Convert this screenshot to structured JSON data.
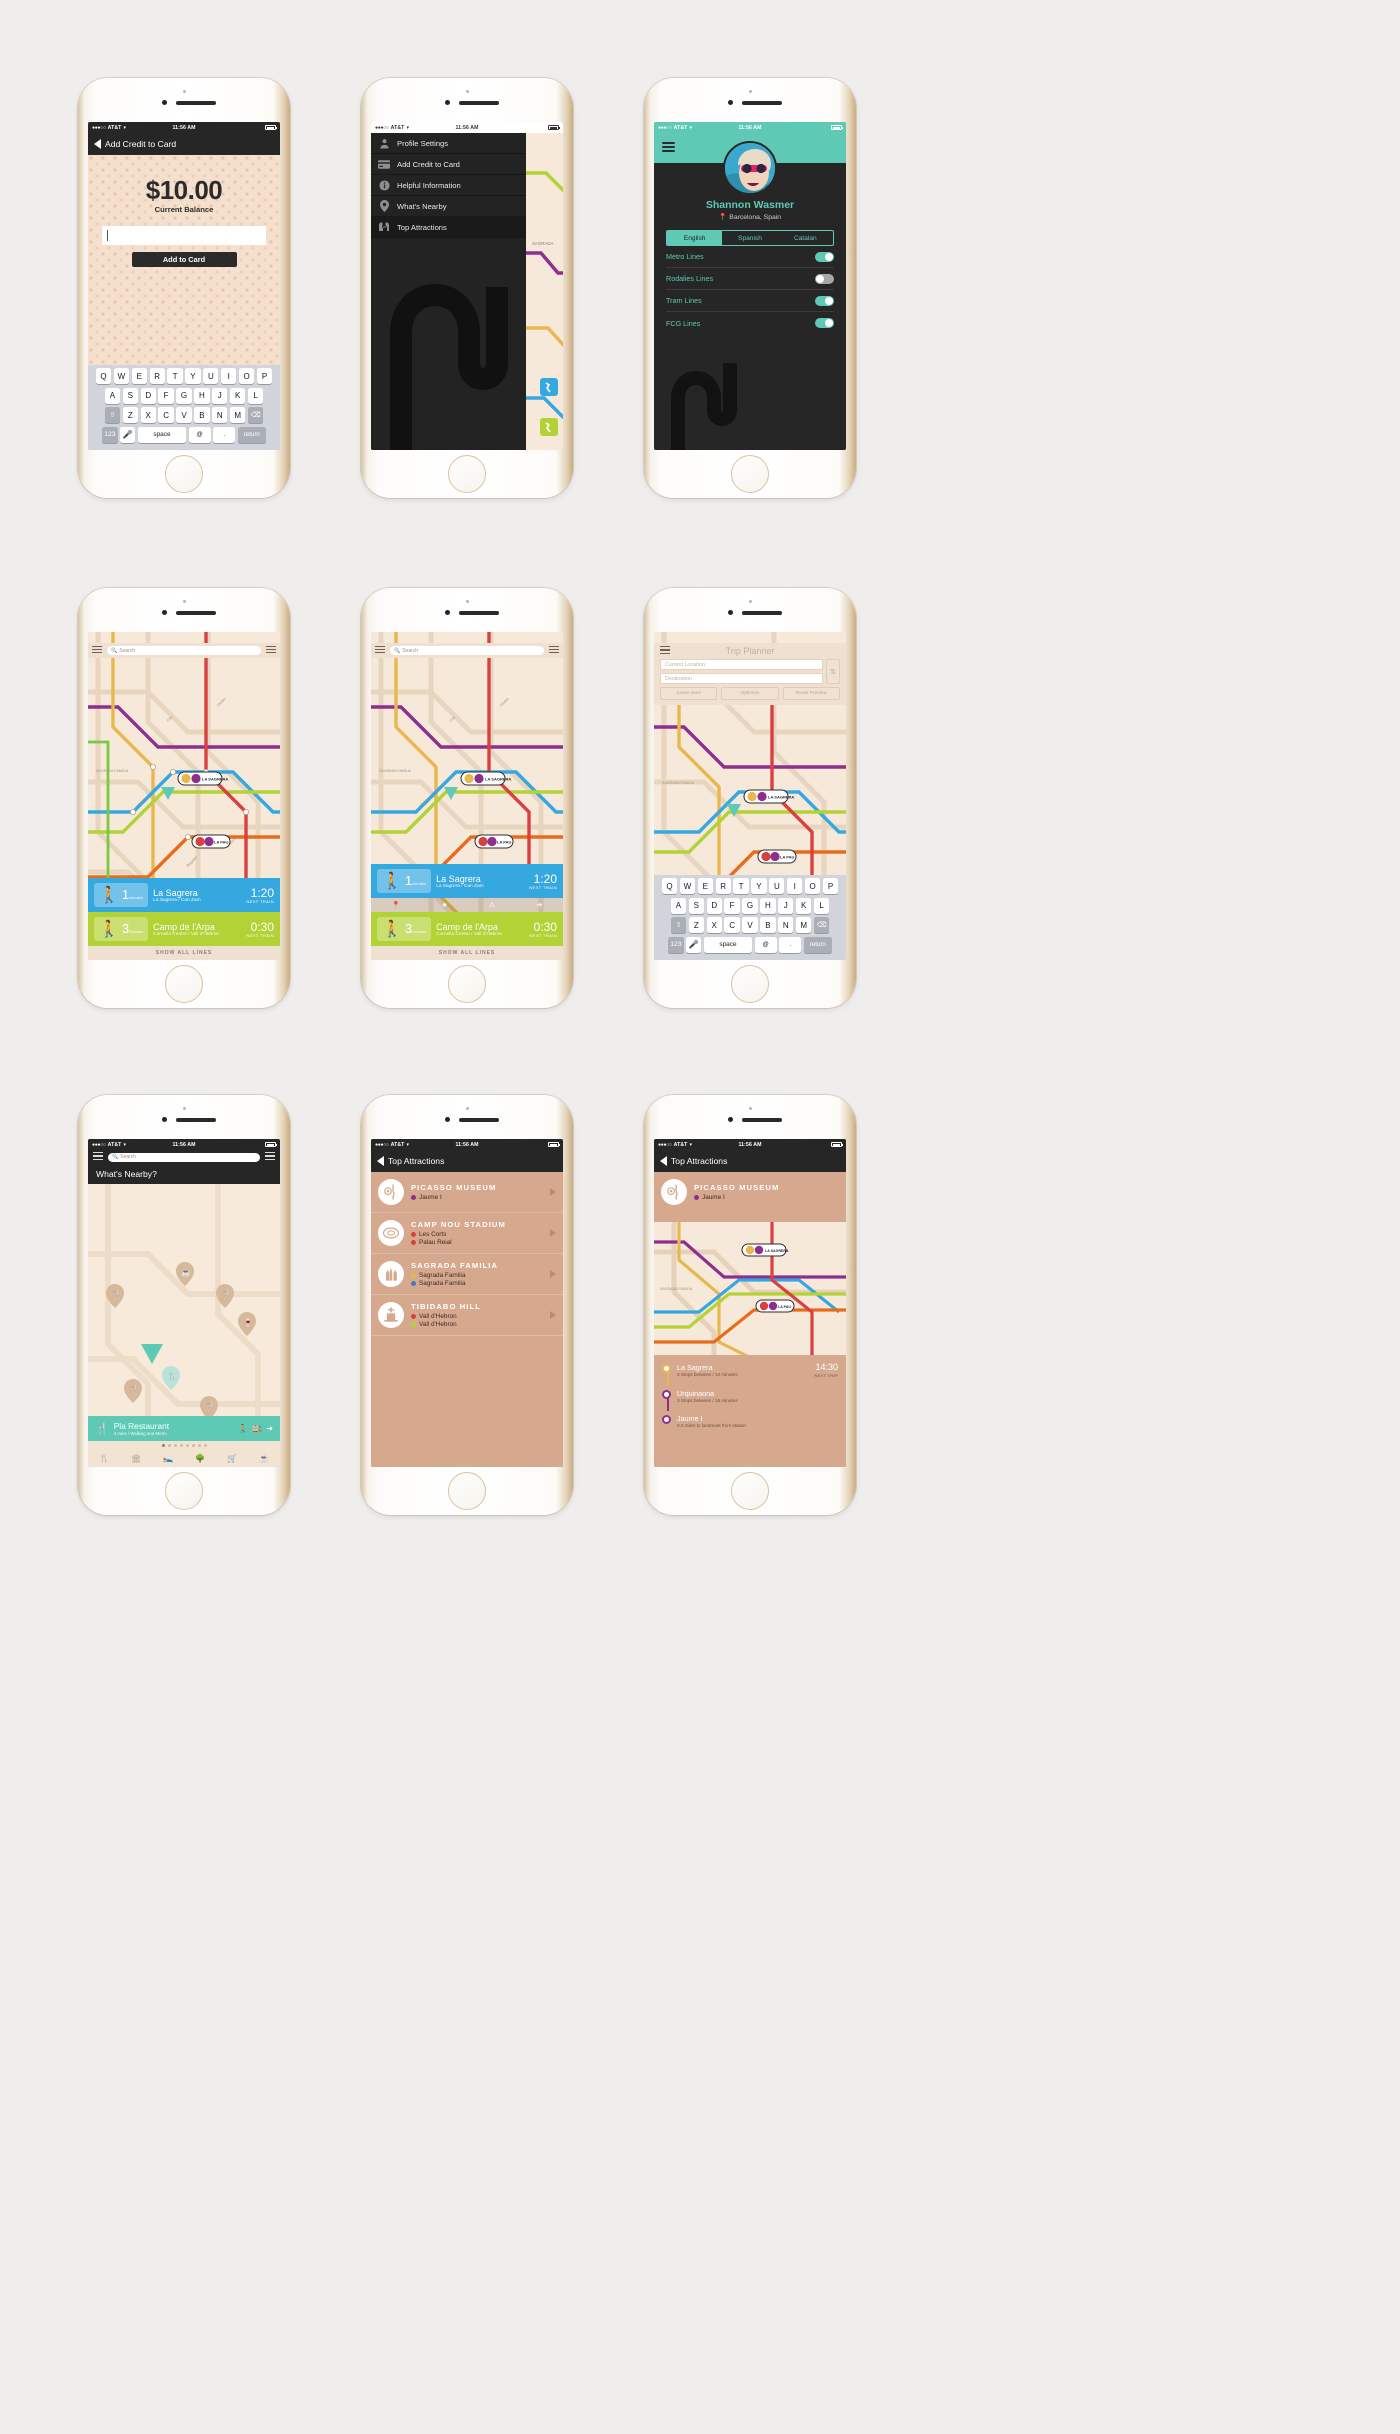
{
  "status_bar": {
    "signal": "●●●○○",
    "carrier": "AT&T",
    "time": "11:56 AM"
  },
  "p1": {
    "nav_title": "Add Credit to Card",
    "amount": "$10.00",
    "amount_label": "Current Balance",
    "input_value": "",
    "button": "Add to Card",
    "keyboard": {
      "row1": [
        "Q",
        "W",
        "E",
        "R",
        "T",
        "Y",
        "U",
        "I",
        "O",
        "P"
      ],
      "row2": [
        "A",
        "S",
        "D",
        "F",
        "G",
        "H",
        "J",
        "K",
        "L"
      ],
      "row3": [
        "Z",
        "X",
        "C",
        "V",
        "B",
        "N",
        "M"
      ],
      "shift": "⇧",
      "backspace": "⌫",
      "num": "123",
      "mic": "\u0001",
      "space": "space",
      "at": "@",
      "period": ".",
      "return": "return"
    }
  },
  "p2": {
    "menu": [
      {
        "label": "Profile Settings",
        "icon": "person-icon"
      },
      {
        "label": "Add Credit to Card",
        "icon": "card-icon"
      },
      {
        "label": "Helpful Information",
        "icon": "info-icon"
      },
      {
        "label": "What's Nearby",
        "icon": "pin-icon"
      },
      {
        "label": "Top Attractions",
        "icon": "metro-icon"
      }
    ],
    "map_label": "SAGRADA"
  },
  "p3": {
    "name": "Shannon Wasmer",
    "location": "Barcelona, Spain",
    "languages": [
      {
        "label": "English",
        "on": true
      },
      {
        "label": "Spanish",
        "on": false
      },
      {
        "label": "Catalan",
        "on": false
      }
    ],
    "toggles": [
      {
        "label": "Metro Lines",
        "on": true
      },
      {
        "label": "Rodalies Lines",
        "on": false
      },
      {
        "label": "Tram Lines",
        "on": true
      },
      {
        "label": "FCG Lines",
        "on": true
      }
    ],
    "accent": "#5ec9b5"
  },
  "p4": {
    "search_placeholder": "Search",
    "routes": [
      {
        "num": "1",
        "unit": "minutes",
        "name": "La Sagrera",
        "sub": "La Sagrera / Can Zam",
        "time": "1:20",
        "time_label": "NEXT TRAIN",
        "color": "#35a8e0"
      },
      {
        "num": "3",
        "unit": "minutes",
        "name": "Camp de l'Arpa",
        "sub": "Cornella Centre / Vall d'Hebron",
        "time": "0:30",
        "time_label": "NEXT TRAIN",
        "color": "#b2d235"
      }
    ],
    "show_all": "SHOW ALL LINES",
    "station_a": "LA SAGRERA",
    "station_b": "LA PAU"
  },
  "p5": {
    "search_placeholder": "Search",
    "routes": [
      {
        "num": "1",
        "unit": "minutes",
        "name": "La Sagrera",
        "sub": "La Sagrera / Can Zam",
        "time": "1:20",
        "time_label": "NEXT TRAIN",
        "color": "#35a8e0"
      },
      {
        "num": "3",
        "unit": "minutes",
        "name": "Camp de l'Arpa",
        "sub": "Cornella Centre / Vall d'Hebron",
        "time": "0:30",
        "time_label": "NEXT TRAIN",
        "color": "#b2d235"
      }
    ],
    "action_icons": [
      "pin-icon",
      "star-icon",
      "warning-icon",
      "share-icon"
    ],
    "show_all": "SHOW ALL LINES"
  },
  "p6": {
    "title": "Trip Planner",
    "origin_placeholder": "Current Location",
    "dest_placeholder": "Destination",
    "buttons": [
      "Leave Now",
      "Optimize",
      "Route Preview"
    ],
    "swap_icon": "swap-icon",
    "keyboard": {
      "row1": [
        "Q",
        "W",
        "E",
        "R",
        "T",
        "Y",
        "U",
        "I",
        "O",
        "P"
      ],
      "row2": [
        "A",
        "S",
        "D",
        "F",
        "G",
        "H",
        "J",
        "K",
        "L"
      ],
      "row3": [
        "Z",
        "X",
        "C",
        "V",
        "B",
        "N",
        "M"
      ],
      "shift": "⇧",
      "backspace": "⌫",
      "num": "123",
      "space": "space",
      "at": "@",
      "period": ".",
      "return": "return"
    }
  },
  "p7": {
    "search_placeholder": "Search",
    "title": "What's Nearby?",
    "card_title": "Pla Restaurant",
    "card_sub": "4 mins / Walking and Metro",
    "categories": [
      "restaurant-icon",
      "museum-icon",
      "hotel-icon",
      "park-icon",
      "shopping-icon",
      "coffee-icon"
    ]
  },
  "p8": {
    "nav_title": "Top Attractions",
    "items": [
      {
        "name": "PICASSO MUSEUM",
        "icon": "picasso-icon",
        "stops": [
          {
            "label": "Jaume I",
            "color": "#8e2f8e"
          }
        ]
      },
      {
        "name": "CAMP NOU STADIUM",
        "icon": "stadium-icon",
        "stops": [
          {
            "label": "Les Corts",
            "color": "#d94141"
          },
          {
            "label": "Palau Reial",
            "color": "#d94141"
          }
        ]
      },
      {
        "name": "SAGRADA FAMILIA",
        "icon": "sagrada-icon",
        "stops": [
          {
            "label": "Sagrada Familia",
            "color": "#e8b84f"
          },
          {
            "label": "Sagrada Familia",
            "color": "#4a77c4"
          }
        ]
      },
      {
        "name": "TIBIDABO HILL",
        "icon": "tibidabo-icon",
        "stops": [
          {
            "label": "Vall d'Hebron",
            "color": "#d94141"
          },
          {
            "label": "Vall d'Hebron",
            "color": "#b2d235"
          }
        ]
      }
    ]
  },
  "p9": {
    "nav_title": "Top Attractions",
    "header": {
      "name": "PICASSO MUSEUM",
      "stop": "Jaume I",
      "stop_color": "#8e2f8e"
    },
    "station_a": "LA SAGRERA",
    "station_b": "LA PAU",
    "steps": [
      {
        "name": "La Sagrera",
        "sub": "3 Stops between / 10 minutes",
        "time": "14:30",
        "time_label": "NEXT TRIP",
        "color": "#e8b84f"
      },
      {
        "name": "Urquinaona",
        "sub": "3 Stops between / 15 minutes",
        "time": "",
        "time_label": "",
        "color": "#8e2f8e"
      },
      {
        "name": "Jaume I",
        "sub": "0.3 miles to landmark from station",
        "time": "",
        "time_label": "",
        "color": "#8e2f8e"
      }
    ]
  }
}
